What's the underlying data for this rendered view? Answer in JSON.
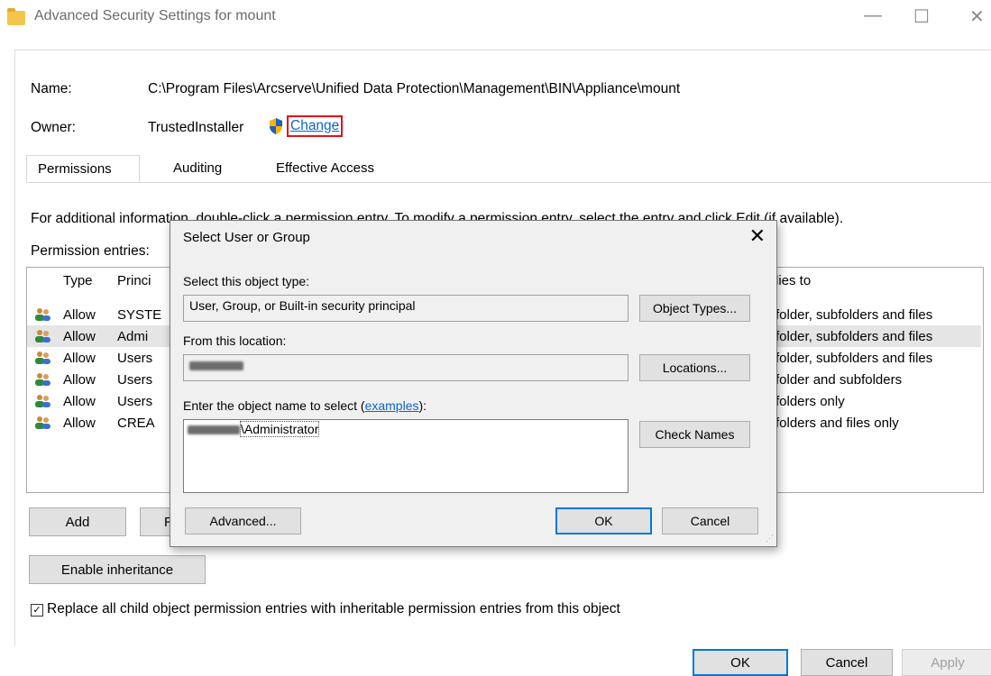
{
  "window": {
    "title": "Advanced Security Settings for mount",
    "controls": {
      "minimize": "—",
      "maximize": "☐",
      "close": "✕"
    }
  },
  "fields": {
    "name_label": "Name:",
    "name_value": "C:\\Program Files\\Arcserve\\Unified Data Protection\\Management\\BIN\\Appliance\\mount",
    "owner_label": "Owner:",
    "owner_value": "TrustedInstaller",
    "change_link": "Change"
  },
  "tabs": [
    "Permissions",
    "Auditing",
    "Effective Access"
  ],
  "info_text": "For additional information, double-click a permission entry. To modify a permission entry, select the entry and click Edit (if available).",
  "entries_label": "Permission entries:",
  "list": {
    "headers": {
      "type": "Type",
      "principal": "Princi",
      "applies": "lies to"
    },
    "rows": [
      {
        "type": "Allow",
        "principal": "SYSTE",
        "applies": "folder, subfolders and files"
      },
      {
        "type": "Allow",
        "principal": "Admi",
        "applies": "folder, subfolders and files"
      },
      {
        "type": "Allow",
        "principal": "Users",
        "applies": "folder, subfolders and files"
      },
      {
        "type": "Allow",
        "principal": "Users",
        "applies": "folder and subfolders"
      },
      {
        "type": "Allow",
        "principal": "Users",
        "applies": "folders only"
      },
      {
        "type": "Allow",
        "principal": "CREA",
        "applies": "folders and files only"
      }
    ]
  },
  "buttons": {
    "add": "Add",
    "remove_partial": "R",
    "enable_inheritance": "Enable inheritance",
    "ok": "OK",
    "cancel": "Cancel",
    "apply": "Apply"
  },
  "replace_checkbox": {
    "label": "Replace all child object permission entries with inheritable permission entries from this object",
    "checked": true
  },
  "dialog": {
    "title": "Select User or Group",
    "object_type_label": "Select this object type:",
    "object_type_value": "User, Group, or Built-in security principal",
    "object_types_button": "Object Types...",
    "location_label": "From this location:",
    "locations_button": "Locations...",
    "enter_label": "Enter the object name to select (",
    "examples_link": "examples",
    "enter_label_end": "):",
    "object_name_suffix": "\\Administrator",
    "check_names_button": "Check Names",
    "advanced_button": "Advanced...",
    "ok_button": "OK",
    "cancel_button": "Cancel"
  }
}
